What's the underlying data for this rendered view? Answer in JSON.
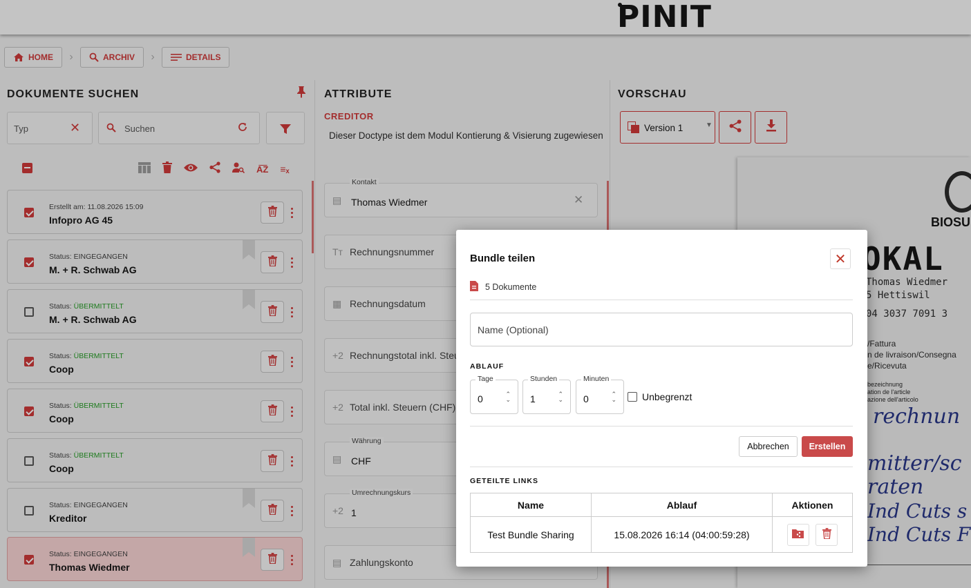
{
  "brand": {
    "logo": "PINIT"
  },
  "breadcrumb": [
    {
      "label": "HOME",
      "icon": "home-icon"
    },
    {
      "label": "ARCHIV",
      "icon": "search-icon"
    },
    {
      "label": "DETAILS",
      "icon": "list-icon"
    }
  ],
  "search_panel": {
    "title": "DOKUMENTE SUCHEN",
    "type_placeholder": "Typ",
    "search_placeholder": "Suchen",
    "toolbar_icons": [
      "columns-icon",
      "trash-icon",
      "eye-icon",
      "share-icon",
      "user-search-icon",
      "sort-az-icon",
      "clear-filter-icon"
    ],
    "items": [
      {
        "sub_label": "Erstellt am:",
        "sub_value": "11.08.2026 15:09",
        "title": "Infopro AG 45",
        "checked": true,
        "bookmarked": false,
        "status_color": "default",
        "selected": false
      },
      {
        "sub_label": "Status:",
        "sub_value": "EINGEGANGEN",
        "title": "M. + R. Schwab AG",
        "checked": true,
        "bookmarked": true,
        "status_color": "default",
        "selected": false
      },
      {
        "sub_label": "Status:",
        "sub_value": "ÜBERMITTELT",
        "title": "M. + R. Schwab AG",
        "checked": false,
        "bookmarked": true,
        "status_color": "green",
        "selected": false
      },
      {
        "sub_label": "Status:",
        "sub_value": "ÜBERMITTELT",
        "title": "Coop",
        "checked": true,
        "bookmarked": false,
        "status_color": "green",
        "selected": false
      },
      {
        "sub_label": "Status:",
        "sub_value": "ÜBERMITTELT",
        "title": "Coop",
        "checked": true,
        "bookmarked": false,
        "status_color": "green",
        "selected": false
      },
      {
        "sub_label": "Status:",
        "sub_value": "ÜBERMITTELT",
        "title": "Coop",
        "checked": false,
        "bookmarked": false,
        "status_color": "green",
        "selected": false
      },
      {
        "sub_label": "Status:",
        "sub_value": "EINGEGANGEN",
        "title": "Kreditor",
        "checked": false,
        "bookmarked": true,
        "status_color": "default",
        "selected": false
      },
      {
        "sub_label": "Status:",
        "sub_value": "EINGEGANGEN",
        "title": "Thomas Wiedmer",
        "checked": true,
        "bookmarked": true,
        "status_color": "default",
        "selected": true
      }
    ]
  },
  "attributes_panel": {
    "title": "ATTRIBUTE",
    "doctype": "CREDITOR",
    "info": "Dieser Doctype ist dem Modul Kontierung & Visierung zugewiesen",
    "fields": [
      {
        "small_label": "Kontakt",
        "value": "Thomas Wiedmer",
        "label": "",
        "icon": "list-icon",
        "icon_text": "▤",
        "clearable": true
      },
      {
        "small_label": "",
        "value": "",
        "label": "Rechnungsnummer",
        "icon": "text-icon",
        "icon_text": "Tт",
        "clearable": false
      },
      {
        "small_label": "",
        "value": "",
        "label": "Rechnungsdatum",
        "icon": "calendar-icon",
        "icon_text": "▦",
        "clearable": false
      },
      {
        "small_label": "",
        "value": "",
        "label": "Rechnungstotal inkl. Steu",
        "icon": "decimal-icon",
        "icon_text": "+2",
        "clearable": false
      },
      {
        "small_label": "",
        "value": "",
        "label": "Total inkl. Steuern (CHF)",
        "icon": "decimal-icon",
        "icon_text": "+2",
        "clearable": false
      },
      {
        "small_label": "Währung",
        "value": "CHF",
        "label": "",
        "icon": "list-icon",
        "icon_text": "▤",
        "clearable": false
      },
      {
        "small_label": "Umrechnungskurs",
        "value": "1",
        "label": "",
        "icon": "decimal-icon",
        "icon_text": "+2",
        "clearable": false
      },
      {
        "small_label": "",
        "value": "",
        "label": "Zahlungskonto",
        "icon": "list-icon",
        "icon_text": "▤",
        "clearable": false
      }
    ]
  },
  "preview_panel": {
    "title": "VORSCHAU",
    "version": "Version 1",
    "doc_text": {
      "brand": "BIOSU",
      "heading": "OKAL",
      "lines": [
        "Thomas Wiedmer",
        "5 Hettiswil",
        "04 3037 7091 3"
      ],
      "fields": [
        "/Fattura",
        "n de livraison/Consegna",
        "e/Ricevuta"
      ],
      "small": [
        "bezeichnung",
        "ation de l'article",
        "azione dell'articolo"
      ],
      "handwriting": [
        "rechnun",
        "mitter/sc",
        "raten",
        "Ind Cuts s",
        "Ind Cuts F"
      ]
    }
  },
  "modal": {
    "title": "Bundle teilen",
    "doc_count": "5 Dokumente",
    "name_placeholder": "Name (Optional)",
    "expiry_label": "ABLAUF",
    "days_label": "Tage",
    "days_value": "0",
    "hours_label": "Stunden",
    "hours_value": "1",
    "minutes_label": "Minuten",
    "minutes_value": "0",
    "unlimited_label": "Unbegrenzt",
    "cancel_label": "Abbrechen",
    "create_label": "Erstellen",
    "shared_links_label": "GETEILTE LINKS",
    "table_headers": [
      "Name",
      "Ablauf",
      "Aktionen"
    ],
    "links": [
      {
        "name": "Test Bundle Sharing",
        "expiry": "15.08.2026 16:14 (04:00:59:28)"
      }
    ]
  }
}
